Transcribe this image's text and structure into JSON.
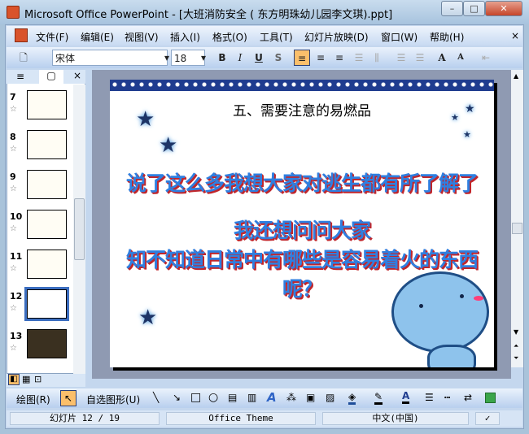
{
  "window": {
    "title": "Microsoft Office PowerPoint - [大班消防安全 ( 东方明珠幼儿园李文琪).ppt]",
    "min": "–",
    "max": "□",
    "close": "✕"
  },
  "menu": [
    "文件(F)",
    "编辑(E)",
    "视图(V)",
    "插入(I)",
    "格式(O)",
    "工具(T)",
    "幻灯片放映(D)",
    "窗口(W)",
    "帮助(H)"
  ],
  "menu_close": "×",
  "toolbar": {
    "font": "宋体",
    "size": "18",
    "bold": "B",
    "italic": "I",
    "underline": "U",
    "shadow": "S",
    "grow": "A",
    "shrink": "A"
  },
  "pane": {
    "tab_outline": "≡",
    "tab_slides": "▢",
    "close": "×"
  },
  "thumbs": [
    {
      "num": "7"
    },
    {
      "num": "8"
    },
    {
      "num": "9"
    },
    {
      "num": "10"
    },
    {
      "num": "11"
    },
    {
      "num": "12"
    },
    {
      "num": "13"
    }
  ],
  "slide": {
    "title": "五、需要注意的易燃品",
    "line1": "说了这么多我想大家对逃生都有所了解了",
    "line2": "我还想问问大家",
    "line3": "知不知道日常中有哪些是容易着火的东西呢？"
  },
  "drawbar": {
    "draw": "绘图(R)",
    "autoshapes": "自选图形(U)"
  },
  "status": {
    "slide": "幻灯片 12 / 19",
    "theme": "Office Theme",
    "lang": "中文(中国)"
  },
  "colors": {
    "accent": "#2f7fe0",
    "shadow": "#c0262c"
  }
}
